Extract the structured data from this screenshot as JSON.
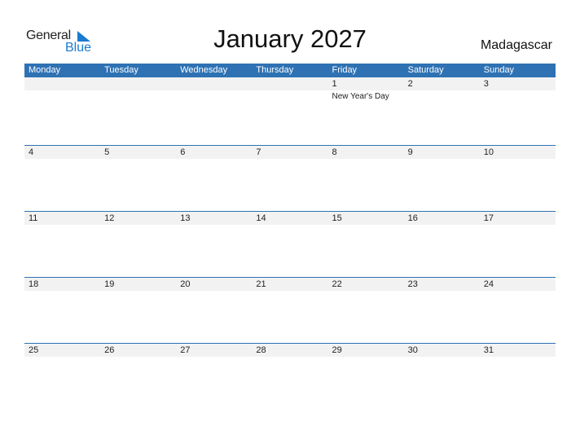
{
  "logo": {
    "line1": "General",
    "line2": "Blue"
  },
  "title": "January 2027",
  "country": "Madagascar",
  "days": [
    "Monday",
    "Tuesday",
    "Wednesday",
    "Thursday",
    "Friday",
    "Saturday",
    "Sunday"
  ],
  "weeks": [
    {
      "dates": [
        "",
        "",
        "",
        "",
        "1",
        "2",
        "3"
      ],
      "events": [
        "",
        "",
        "",
        "",
        "New Year's Day",
        "",
        ""
      ]
    },
    {
      "dates": [
        "4",
        "5",
        "6",
        "7",
        "8",
        "9",
        "10"
      ],
      "events": [
        "",
        "",
        "",
        "",
        "",
        "",
        ""
      ]
    },
    {
      "dates": [
        "11",
        "12",
        "13",
        "14",
        "15",
        "16",
        "17"
      ],
      "events": [
        "",
        "",
        "",
        "",
        "",
        "",
        ""
      ]
    },
    {
      "dates": [
        "18",
        "19",
        "20",
        "21",
        "22",
        "23",
        "24"
      ],
      "events": [
        "",
        "",
        "",
        "",
        "",
        "",
        ""
      ]
    },
    {
      "dates": [
        "25",
        "26",
        "27",
        "28",
        "29",
        "30",
        "31"
      ],
      "events": [
        "",
        "",
        "",
        "",
        "",
        "",
        ""
      ]
    }
  ],
  "colors": {
    "accent": "#2e72b4",
    "logo_blue": "#1a7bd0",
    "date_strip": "#f2f2f2"
  }
}
